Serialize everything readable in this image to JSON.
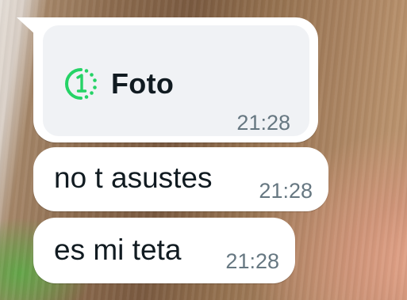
{
  "chat": {
    "messages": [
      {
        "type": "view_once_photo",
        "label": "Foto",
        "icon": "view-once-icon",
        "time": "21:28"
      },
      {
        "type": "text",
        "text": "no t asustes",
        "time": "21:28"
      },
      {
        "type": "text",
        "text": "es mi teta",
        "time": "21:28"
      }
    ]
  },
  "colors": {
    "bubble": "#ffffff",
    "photo_card": "#f0f2f5",
    "view_once_green": "#25d366",
    "text_primary": "#111b21",
    "timestamp": "#667781"
  }
}
